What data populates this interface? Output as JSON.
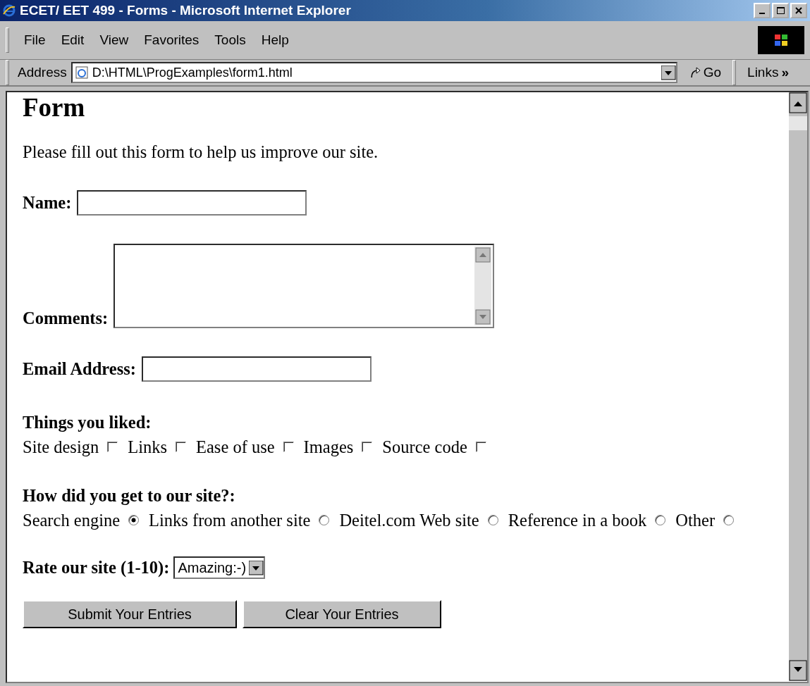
{
  "window": {
    "title": "ECET/ EET 499 - Forms - Microsoft Internet Explorer"
  },
  "menu": [
    "File",
    "Edit",
    "View",
    "Favorites",
    "Tools",
    "Help"
  ],
  "address_bar": {
    "label": "Address",
    "value": "D:\\HTML\\ProgExamples\\form1.html",
    "go": "Go",
    "links": "Links",
    "links_more": "»"
  },
  "page": {
    "heading": "Form",
    "intro": "Please fill out this form to help us improve our site.",
    "name_label": "Name:",
    "comments_label": "Comments:",
    "email_label": "Email Address:",
    "liked_label": "Things you liked:",
    "liked": [
      {
        "label": "Site design",
        "checked": false
      },
      {
        "label": "Links",
        "checked": false
      },
      {
        "label": "Ease of use",
        "checked": false
      },
      {
        "label": "Images",
        "checked": false
      },
      {
        "label": "Source code",
        "checked": false
      }
    ],
    "source_label": "How did you get to our site?:",
    "sources": [
      {
        "label": "Search engine",
        "selected": true
      },
      {
        "label": "Links from another site",
        "selected": false
      },
      {
        "label": "Deitel.com Web site",
        "selected": false
      },
      {
        "label": "Reference in a book",
        "selected": false
      },
      {
        "label": "Other",
        "selected": false
      }
    ],
    "rate_label": "Rate our site (1-10):",
    "rate_value": "Amazing:-)",
    "buttons": [
      "Submit Your Entries",
      "Clear Your Entries"
    ]
  }
}
